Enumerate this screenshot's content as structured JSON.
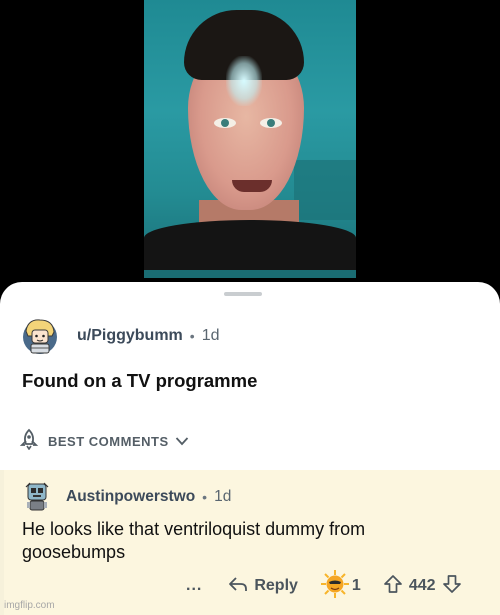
{
  "post": {
    "username": "u/Piggybumm",
    "separator": "•",
    "age": "1d",
    "title": "Found on a TV programme"
  },
  "sort": {
    "label": "BEST COMMENTS"
  },
  "comment": {
    "username": "Austinpowerstwo",
    "separator": "•",
    "age": "1d",
    "body": "He looks like that ventriloquist dummy from goosebumps",
    "more": "...",
    "reply_label": "Reply",
    "award_count": "1",
    "vote_count": "442"
  },
  "watermark": "imgflip.com",
  "icons": {
    "sort": "best-rocket-icon",
    "chevron": "chevron-down-icon",
    "reply": "reply-arrow-icon",
    "award": "sun-award-icon",
    "upvote": "upvote-arrow-icon",
    "downvote": "downvote-arrow-icon"
  },
  "colors": {
    "comment_highlight": "#fcf6df",
    "photo_background": "#238b92",
    "username": "#3c4a5a"
  }
}
